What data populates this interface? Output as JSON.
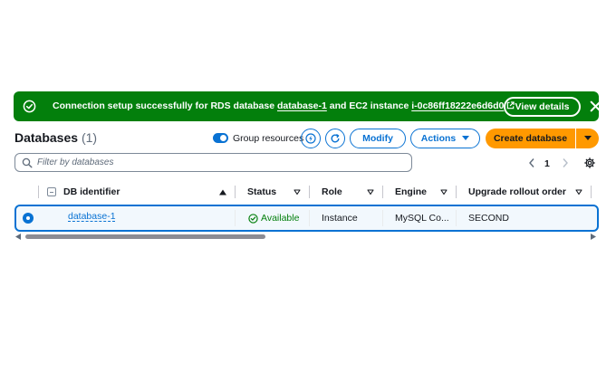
{
  "banner": {
    "text_before": "Connection setup successfully for RDS database ",
    "db_link": "database-1",
    "text_middle": " and EC2 instance ",
    "instance_link": "i-0c86ff18222e6d6d0",
    "view_details_label": "View details",
    "icons": {
      "status": "success-check-icon",
      "external": "external-link-icon",
      "close": "close-icon"
    },
    "color": "#037f0c"
  },
  "header": {
    "title": "Databases",
    "count": "(1)",
    "group_resources_label": "Group resources",
    "group_resources_enabled": true,
    "modify_label": "Modify",
    "actions_label": "Actions",
    "create_label": "Create database",
    "accent_color": "#0972d3",
    "primary_color": "#ff9900"
  },
  "filter": {
    "placeholder": "Filter by databases",
    "value": ""
  },
  "pagination": {
    "current_page": "1"
  },
  "table": {
    "columns": [
      {
        "label": "DB identifier",
        "sort": "ascending"
      },
      {
        "label": "Status",
        "sort": "none"
      },
      {
        "label": "Role",
        "sort": "none"
      },
      {
        "label": "Engine",
        "sort": "none"
      },
      {
        "label": "Upgrade rollout order",
        "sort": "none"
      }
    ],
    "rows": [
      {
        "selected": true,
        "db_identifier": "database-1",
        "status": "Available",
        "role": "Instance",
        "engine": "MySQL Co...",
        "upgrade_rollout_order": "SECOND"
      }
    ]
  }
}
